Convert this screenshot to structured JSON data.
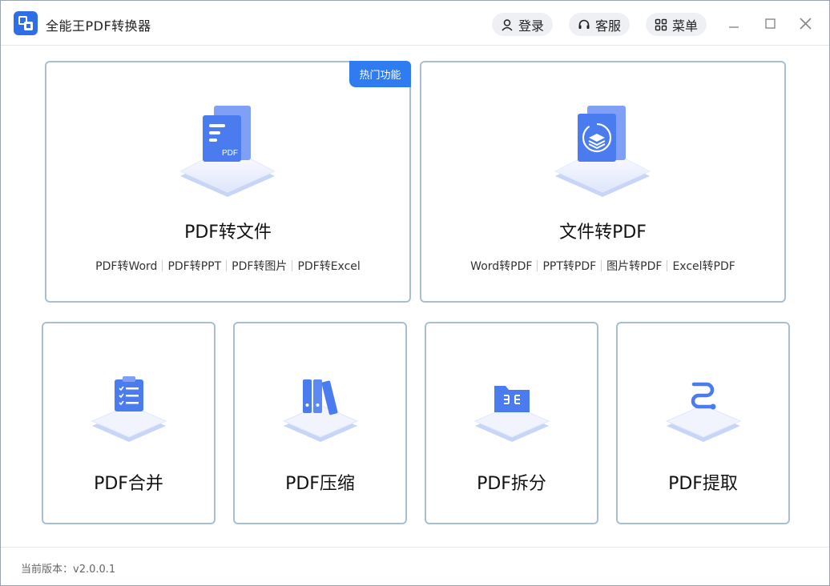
{
  "app": {
    "title": "全能王PDF转换器",
    "logo_icon": "app-logo-icon"
  },
  "toolbar": {
    "login_label": "登录",
    "service_label": "客服",
    "menu_label": "菜单"
  },
  "cards": {
    "pdf_to_file": {
      "badge": "热门功能",
      "title": "PDF转文件",
      "links": [
        "PDF转Word",
        "PDF转PPT",
        "PDF转图片",
        "PDF转Excel"
      ],
      "icon": "pdf-document-icon"
    },
    "file_to_pdf": {
      "title": "文件转PDF",
      "links": [
        "Word转PDF",
        "PPT转PDF",
        "图片转PDF",
        "Excel转PDF"
      ],
      "icon": "convert-layers-icon"
    },
    "merge": {
      "title": "PDF合并",
      "icon": "clipboard-checklist-icon"
    },
    "compress": {
      "title": "PDF压缩",
      "icon": "binders-icon"
    },
    "split": {
      "title": "PDF拆分",
      "icon": "folder-split-icon"
    },
    "extract": {
      "title": "PDF提取",
      "icon": "path-extract-icon"
    }
  },
  "footer": {
    "version": "当前版本：v2.0.0.1"
  },
  "colors": {
    "accent": "#2f7bf0",
    "card_border": "#a9bfd1",
    "icon_blue": "#4a7cf0"
  }
}
